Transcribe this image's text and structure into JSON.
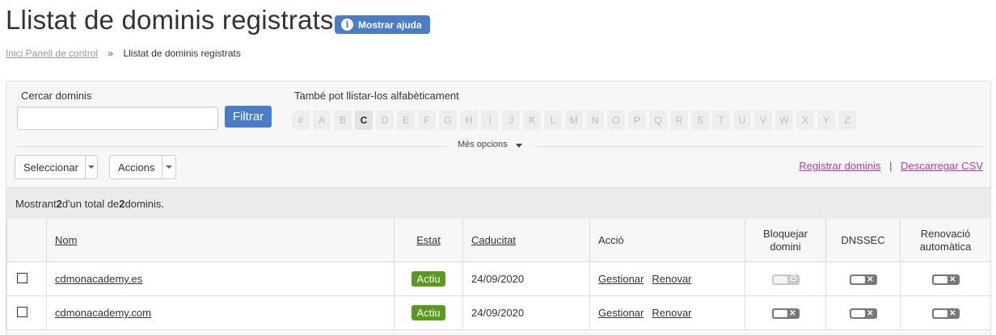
{
  "page": {
    "title": "Llistat de dominis registrats",
    "help_button": "Mostrar ajuda"
  },
  "breadcrumb": {
    "home": "Inici Panell de control",
    "separator": "»",
    "current": "Llistat de dominis registrats"
  },
  "search": {
    "label": "Cercar dominis",
    "value": "",
    "placeholder": "",
    "filter_button": "Filtrar"
  },
  "alphabet": {
    "label": "També pot llistar-los alfabèticament",
    "letters": [
      "#",
      "A",
      "B",
      "C",
      "D",
      "E",
      "F",
      "G",
      "H",
      "I",
      "J",
      "K",
      "L",
      "M",
      "N",
      "O",
      "P",
      "Q",
      "R",
      "S",
      "T",
      "U",
      "V",
      "W",
      "X",
      "Y",
      "Z"
    ],
    "active": "C"
  },
  "more_options": "Més opcions",
  "toolbar": {
    "select_label": "Seleccionar",
    "actions_label": "Accions",
    "register_link": "Registrar dominis",
    "link_separator": "|",
    "csv_link": "Descarregar CSV"
  },
  "summary": {
    "prefix": "Mostrant ",
    "shown": "2",
    "middle": " d'un total de ",
    "total": "2",
    "suffix": " dominis."
  },
  "table": {
    "headers": {
      "name": "Nom",
      "status": "Estat",
      "expiry": "Caducitat",
      "action": "Acció",
      "lock": "Bloquejar domini",
      "dnssec": "DNSSEC",
      "autorenew": "Renovació automàtica"
    },
    "rows": [
      {
        "domain": "cdmonacademy.es",
        "status": "Actiu",
        "expiry": "24/09/2020",
        "manage": "Gestionar",
        "renew": "Renovar",
        "lock": "disabled-locked",
        "dnssec": "off",
        "autorenew": "off"
      },
      {
        "domain": "cdmonacademy.com",
        "status": "Actiu",
        "expiry": "24/09/2020",
        "manage": "Gestionar",
        "renew": "Renovar",
        "lock": "off",
        "dnssec": "off",
        "autorenew": "off"
      }
    ]
  },
  "colors": {
    "primary_button": "#4a7dc7",
    "status_active": "#5a9a1f",
    "link_magenta": "#c0399a"
  }
}
